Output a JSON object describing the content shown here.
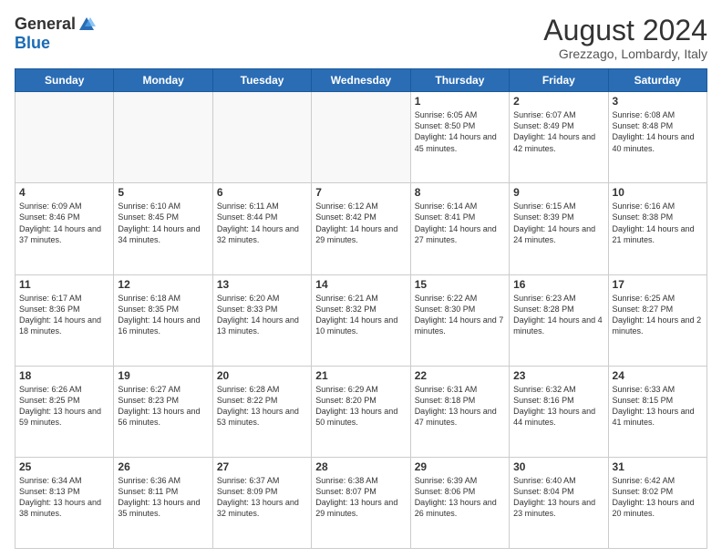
{
  "logo": {
    "general": "General",
    "blue": "Blue"
  },
  "title": {
    "month": "August 2024",
    "location": "Grezzago, Lombardy, Italy"
  },
  "headers": [
    "Sunday",
    "Monday",
    "Tuesday",
    "Wednesday",
    "Thursday",
    "Friday",
    "Saturday"
  ],
  "weeks": [
    [
      {
        "day": "",
        "info": ""
      },
      {
        "day": "",
        "info": ""
      },
      {
        "day": "",
        "info": ""
      },
      {
        "day": "",
        "info": ""
      },
      {
        "day": "1",
        "info": "Sunrise: 6:05 AM\nSunset: 8:50 PM\nDaylight: 14 hours\nand 45 minutes."
      },
      {
        "day": "2",
        "info": "Sunrise: 6:07 AM\nSunset: 8:49 PM\nDaylight: 14 hours\nand 42 minutes."
      },
      {
        "day": "3",
        "info": "Sunrise: 6:08 AM\nSunset: 8:48 PM\nDaylight: 14 hours\nand 40 minutes."
      }
    ],
    [
      {
        "day": "4",
        "info": "Sunrise: 6:09 AM\nSunset: 8:46 PM\nDaylight: 14 hours\nand 37 minutes."
      },
      {
        "day": "5",
        "info": "Sunrise: 6:10 AM\nSunset: 8:45 PM\nDaylight: 14 hours\nand 34 minutes."
      },
      {
        "day": "6",
        "info": "Sunrise: 6:11 AM\nSunset: 8:44 PM\nDaylight: 14 hours\nand 32 minutes."
      },
      {
        "day": "7",
        "info": "Sunrise: 6:12 AM\nSunset: 8:42 PM\nDaylight: 14 hours\nand 29 minutes."
      },
      {
        "day": "8",
        "info": "Sunrise: 6:14 AM\nSunset: 8:41 PM\nDaylight: 14 hours\nand 27 minutes."
      },
      {
        "day": "9",
        "info": "Sunrise: 6:15 AM\nSunset: 8:39 PM\nDaylight: 14 hours\nand 24 minutes."
      },
      {
        "day": "10",
        "info": "Sunrise: 6:16 AM\nSunset: 8:38 PM\nDaylight: 14 hours\nand 21 minutes."
      }
    ],
    [
      {
        "day": "11",
        "info": "Sunrise: 6:17 AM\nSunset: 8:36 PM\nDaylight: 14 hours\nand 18 minutes."
      },
      {
        "day": "12",
        "info": "Sunrise: 6:18 AM\nSunset: 8:35 PM\nDaylight: 14 hours\nand 16 minutes."
      },
      {
        "day": "13",
        "info": "Sunrise: 6:20 AM\nSunset: 8:33 PM\nDaylight: 14 hours\nand 13 minutes."
      },
      {
        "day": "14",
        "info": "Sunrise: 6:21 AM\nSunset: 8:32 PM\nDaylight: 14 hours\nand 10 minutes."
      },
      {
        "day": "15",
        "info": "Sunrise: 6:22 AM\nSunset: 8:30 PM\nDaylight: 14 hours\nand 7 minutes."
      },
      {
        "day": "16",
        "info": "Sunrise: 6:23 AM\nSunset: 8:28 PM\nDaylight: 14 hours\nand 4 minutes."
      },
      {
        "day": "17",
        "info": "Sunrise: 6:25 AM\nSunset: 8:27 PM\nDaylight: 14 hours\nand 2 minutes."
      }
    ],
    [
      {
        "day": "18",
        "info": "Sunrise: 6:26 AM\nSunset: 8:25 PM\nDaylight: 13 hours\nand 59 minutes."
      },
      {
        "day": "19",
        "info": "Sunrise: 6:27 AM\nSunset: 8:23 PM\nDaylight: 13 hours\nand 56 minutes."
      },
      {
        "day": "20",
        "info": "Sunrise: 6:28 AM\nSunset: 8:22 PM\nDaylight: 13 hours\nand 53 minutes."
      },
      {
        "day": "21",
        "info": "Sunrise: 6:29 AM\nSunset: 8:20 PM\nDaylight: 13 hours\nand 50 minutes."
      },
      {
        "day": "22",
        "info": "Sunrise: 6:31 AM\nSunset: 8:18 PM\nDaylight: 13 hours\nand 47 minutes."
      },
      {
        "day": "23",
        "info": "Sunrise: 6:32 AM\nSunset: 8:16 PM\nDaylight: 13 hours\nand 44 minutes."
      },
      {
        "day": "24",
        "info": "Sunrise: 6:33 AM\nSunset: 8:15 PM\nDaylight: 13 hours\nand 41 minutes."
      }
    ],
    [
      {
        "day": "25",
        "info": "Sunrise: 6:34 AM\nSunset: 8:13 PM\nDaylight: 13 hours\nand 38 minutes."
      },
      {
        "day": "26",
        "info": "Sunrise: 6:36 AM\nSunset: 8:11 PM\nDaylight: 13 hours\nand 35 minutes."
      },
      {
        "day": "27",
        "info": "Sunrise: 6:37 AM\nSunset: 8:09 PM\nDaylight: 13 hours\nand 32 minutes."
      },
      {
        "day": "28",
        "info": "Sunrise: 6:38 AM\nSunset: 8:07 PM\nDaylight: 13 hours\nand 29 minutes."
      },
      {
        "day": "29",
        "info": "Sunrise: 6:39 AM\nSunset: 8:06 PM\nDaylight: 13 hours\nand 26 minutes."
      },
      {
        "day": "30",
        "info": "Sunrise: 6:40 AM\nSunset: 8:04 PM\nDaylight: 13 hours\nand 23 minutes."
      },
      {
        "day": "31",
        "info": "Sunrise: 6:42 AM\nSunset: 8:02 PM\nDaylight: 13 hours\nand 20 minutes."
      }
    ]
  ]
}
